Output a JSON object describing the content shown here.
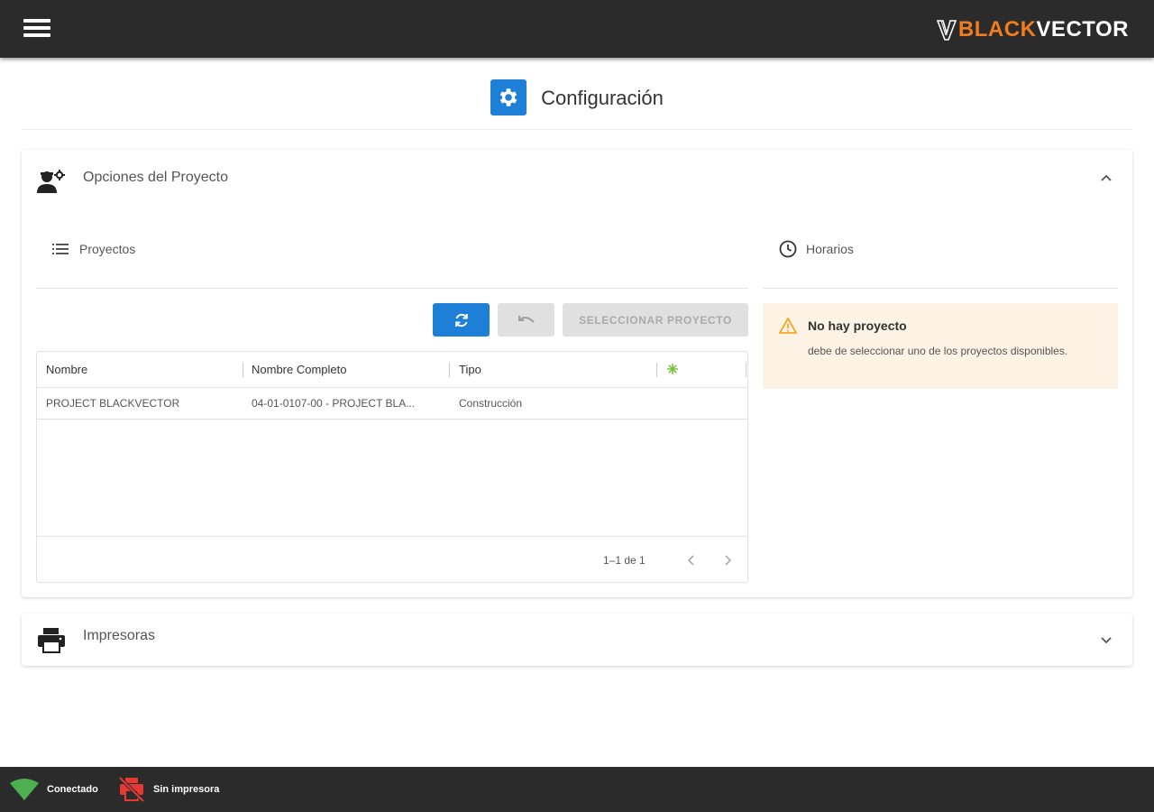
{
  "app": {
    "brand_black": "BLACK",
    "brand_vector": "VECTOR",
    "brand_color": "#f07d1f"
  },
  "header": {
    "title": "Configuración",
    "icon": "gear-icon"
  },
  "project_panel": {
    "title": "Opciones del Proyecto",
    "projects_section": {
      "label": "Proyectos",
      "icon": "list-icon"
    },
    "schedules_section": {
      "label": "Horarios",
      "icon": "clock-icon"
    },
    "toolbar": {
      "refresh": "refresh-icon",
      "undo": "undo-icon",
      "select_label": "SELECCIONAR PROYECTO"
    },
    "table": {
      "columns": [
        "Nombre",
        "Nombre Completo",
        "Tipo"
      ],
      "rows": [
        {
          "nombre": "PROJECT BLACKVECTOR",
          "nombre_completo": "04-01-0107-00 - PROJECT BLA...",
          "tipo": "Construcción"
        }
      ],
      "pagination": "1–1 de 1"
    },
    "alert": {
      "title": "No hay proyecto",
      "message": "debe de seleccionar uno de los proyectos disponibles."
    }
  },
  "printers_panel": {
    "title": "Impresoras"
  },
  "status": {
    "connection": "Conectado",
    "printer": "Sin impresora"
  },
  "colors": {
    "primary": "#1e7fd6",
    "warning": "#f5a623",
    "connected": "#4caf50",
    "error": "#e53935"
  }
}
